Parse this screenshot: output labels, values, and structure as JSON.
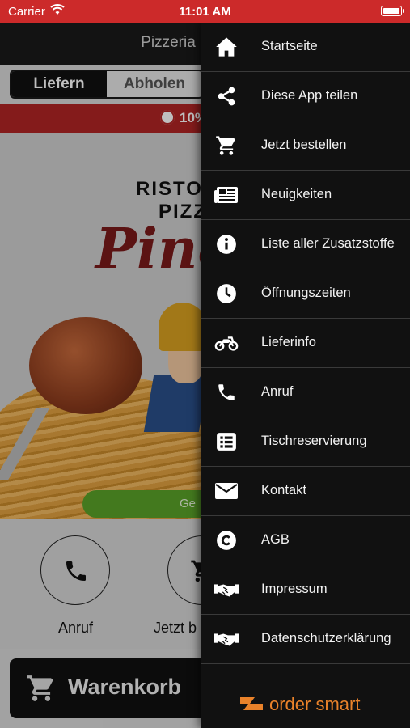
{
  "status_bar": {
    "carrier": "Carrier",
    "time": "11:01 AM"
  },
  "app": {
    "title": "Pizzeria",
    "segments": [
      {
        "label": "Liefern",
        "active": true
      },
      {
        "label": "Abholen",
        "active": false
      }
    ],
    "promo_text": "10%",
    "hero": {
      "logo_line1": "RISTO",
      "logo_line2": "PIZZ",
      "logo_script": "Pino",
      "green_button_label": "Ge"
    },
    "actions": [
      {
        "label": "Anruf",
        "icon": "phone-icon"
      },
      {
        "label": "Jetzt b",
        "icon": "cart-icon"
      }
    ],
    "cart_label": "Warenkorb"
  },
  "drawer": {
    "items": [
      {
        "label": "Startseite",
        "icon": "home-icon"
      },
      {
        "label": "Diese App teilen",
        "icon": "share-icon"
      },
      {
        "label": "Jetzt bestellen",
        "icon": "cart-icon"
      },
      {
        "label": "Neuigkeiten",
        "icon": "newspaper-icon"
      },
      {
        "label": "Liste aller Zusatzstoffe",
        "icon": "info-icon"
      },
      {
        "label": "Öffnungszeiten",
        "icon": "clock-icon"
      },
      {
        "label": "Lieferinfo",
        "icon": "motorcycle-icon"
      },
      {
        "label": "Anruf",
        "icon": "phone-icon"
      },
      {
        "label": "Tischreservierung",
        "icon": "list-icon"
      },
      {
        "label": "Kontakt",
        "icon": "envelope-icon"
      },
      {
        "label": "AGB",
        "icon": "copyright-icon"
      },
      {
        "label": "Impressum",
        "icon": "handshake-icon"
      },
      {
        "label": "Datenschutzerklärung",
        "icon": "handshake-icon"
      }
    ],
    "brand": "order smart"
  },
  "colors": {
    "status_bar": "#cc2a2a",
    "drawer_bg": "#111111",
    "accent_orange": "#e9822a",
    "promo_bg": "#b02424",
    "green_button": "#5aa228"
  }
}
